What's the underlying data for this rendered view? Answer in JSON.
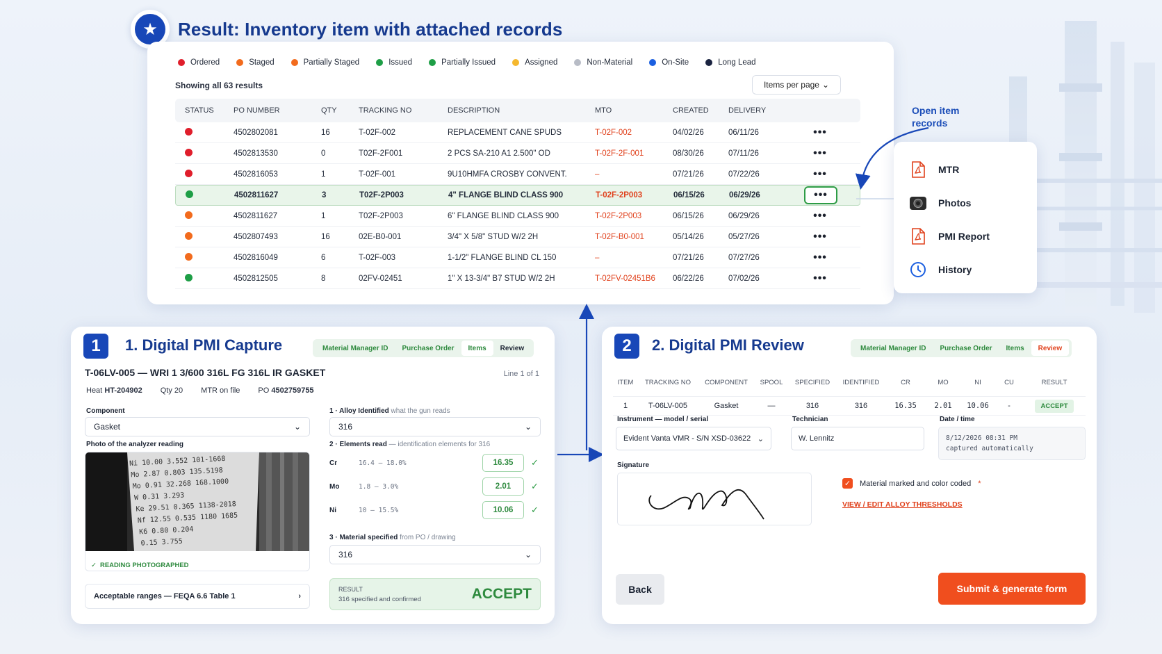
{
  "title": "Result:  Inventory item with attached records",
  "legend": [
    {
      "label": "Ordered",
      "color": "#e01e2b"
    },
    {
      "label": "Staged",
      "color": "#f26b1d"
    },
    {
      "label": "Partially Staged",
      "color": "#f26b1d"
    },
    {
      "label": "Issued",
      "color": "#1e9e46"
    },
    {
      "label": "Partially Issued",
      "color": "#1e9e46"
    },
    {
      "label": "Assigned",
      "color": "#f5b82e"
    },
    {
      "label": "Non-Material",
      "color": "#b8bcc6"
    },
    {
      "label": "On-Site",
      "color": "#1b5fe0"
    },
    {
      "label": "Long Lead",
      "color": "#1a2340"
    }
  ],
  "showing": "Showing all 63 results",
  "items_per_page": "Items per page",
  "table": {
    "headers": [
      "STATUS",
      "PO NUMBER",
      "QTY",
      "TRACKING NO",
      "DESCRIPTION",
      "MTO",
      "CREATED",
      "DELIVERY"
    ],
    "rows": [
      {
        "status_color": "#e01e2b",
        "po": "4502802081",
        "qty": "16",
        "tracking": "T-02F-002",
        "desc": "REPLACEMENT CANE SPUDS",
        "mto": "T-02F-002",
        "created": "04/02/26",
        "delivery": "06/11/26"
      },
      {
        "status_color": "#e01e2b",
        "po": "4502813530",
        "qty": "0",
        "tracking": "T02F-2F001",
        "desc": "2 PCS SA-210 A1 2.500\" OD",
        "mto": "T-02F-2F-001",
        "created": "08/30/26",
        "delivery": "07/11/26"
      },
      {
        "status_color": "#e01e2b",
        "po": "4502816053",
        "qty": "1",
        "tracking": "T-02F-001",
        "desc": "9U10HMFA CROSBY CONVENT.",
        "mto": "–",
        "created": "07/21/26",
        "delivery": "07/22/26"
      },
      {
        "status_color": "#1e9e46",
        "po": "4502811627",
        "qty": "3",
        "tracking": "T02F-2P003",
        "desc": "4\" FLANGE BLIND CLASS 900",
        "mto": "T-02F-2P003",
        "created": "06/15/26",
        "delivery": "06/29/26",
        "highlight": true
      },
      {
        "status_color": "#f26b1d",
        "po": "4502811627",
        "qty": "1",
        "tracking": "T02F-2P003",
        "desc": "6\" FLANGE BLIND CLASS 900",
        "mto": "T-02F-2P003",
        "created": "06/15/26",
        "delivery": "06/29/26"
      },
      {
        "status_color": "#f26b1d",
        "po": "4502807493",
        "qty": "16",
        "tracking": "02E-B0-001",
        "desc": "3/4\" X 5/8\" STUD W/2 2H",
        "mto": "T-02F-B0-001",
        "created": "05/14/26",
        "delivery": "05/27/26"
      },
      {
        "status_color": "#f26b1d",
        "po": "4502816049",
        "qty": "6",
        "tracking": "T-02F-003",
        "desc": "1-1/2\" FLANGE BLIND CL 150",
        "mto": "–",
        "created": "07/21/26",
        "delivery": "07/27/26"
      },
      {
        "status_color": "#1e9e46",
        "po": "4502812505",
        "qty": "8",
        "tracking": "02FV-02451",
        "desc": "1\" X 13-3/4\" B7 STUD W/2 2H",
        "mto": "T-02FV-02451B6",
        "created": "06/22/26",
        "delivery": "07/02/26"
      }
    ],
    "more": "•••"
  },
  "open_records_label": "Open item records",
  "records_menu": [
    {
      "label": "MTR",
      "icon": "pdf-icon"
    },
    {
      "label": "Photos",
      "icon": "camera-icon"
    },
    {
      "label": "PMI Report",
      "icon": "pdf-icon"
    },
    {
      "label": "History",
      "icon": "clock-icon"
    }
  ],
  "capture": {
    "number": "1",
    "title": "1. Digital PMI Capture",
    "tabs": [
      "Material Manager ID",
      "Purchase Order",
      "Items",
      "Review"
    ],
    "item_title": "T-06LV-005 — WRI 1 3/600 316L FG 316L IR GASKET",
    "line_of": "Line 1 of 1",
    "heat_label": "Heat",
    "heat": "HT-204902",
    "qty": "Qty 20",
    "mtr": "MTR on file",
    "po_label": "PO",
    "po": "4502759755",
    "component_label": "Component",
    "component": "Gasket",
    "photo_label": "Photo of the analyzer reading",
    "photo_caption": "READING PHOTOGRAPHED",
    "acceptable": "Acceptable ranges — FEQA 6.6 Table 1",
    "alloy_label": "1 · Alloy Identified",
    "alloy_sub": "what the gun reads",
    "alloy": "316",
    "elements_label": "2 · Elements read",
    "elements_sub": "— identification elements for 316",
    "elements": [
      {
        "sym": "Cr",
        "range": "16.4 – 18.0%",
        "value": "16.35"
      },
      {
        "sym": "Mo",
        "range": "1.8 – 3.0%",
        "value": "2.01"
      },
      {
        "sym": "Ni",
        "range": "10 – 15.5%",
        "value": "10.06"
      }
    ],
    "specified_label": "3 · Material specified",
    "specified_sub": "from PO / drawing",
    "specified": "316",
    "result_label": "RESULT",
    "result_sub": "316 specified and confirmed",
    "result": "ACCEPT",
    "photo_text": [
      "Ni  10.00 3.552 101-1668",
      "Mo  2.87 0.803 135.5198",
      "Mo  0.91 32.268 168.1000",
      "W   0.31 3.293",
      "Ke  29.51 0.365 1138-2018",
      "Nf  12.55 0.535 1180 1685",
      "K6  0.80 0.204",
      "    0.15 3.755"
    ]
  },
  "review": {
    "number": "2",
    "title": "2. Digital PMI Review",
    "tabs": [
      "Material Manager ID",
      "Purchase Order",
      "Items",
      "Review"
    ],
    "headers": [
      "ITEM",
      "TRACKING NO",
      "COMPONENT",
      "SPOOL",
      "SPECIFIED",
      "IDENTIFIED",
      "CR",
      "MO",
      "NI",
      "CU",
      "RESULT"
    ],
    "row": [
      "1",
      "T-06LV-005",
      "Gasket",
      "—",
      "316",
      "316",
      "16.35",
      "2.01",
      "10.06",
      "-",
      "ACCEPT"
    ],
    "instrument_label": "Instrument — model / serial",
    "instrument": "Evident Vanta VMR - S/N XSD-03622",
    "technician_label": "Technician",
    "technician": "W. Lennitz",
    "date_label": "Date / time",
    "date": "8/12/2026  08:31 PM",
    "date_sub": "captured automatically",
    "signature_label": "Signature",
    "checkbox_label": "Material marked and color coded",
    "required_mark": "*",
    "thresholds_link": "VIEW / EDIT ALLOY THRESHOLDS",
    "back": "Back",
    "submit": "Submit & generate form"
  }
}
